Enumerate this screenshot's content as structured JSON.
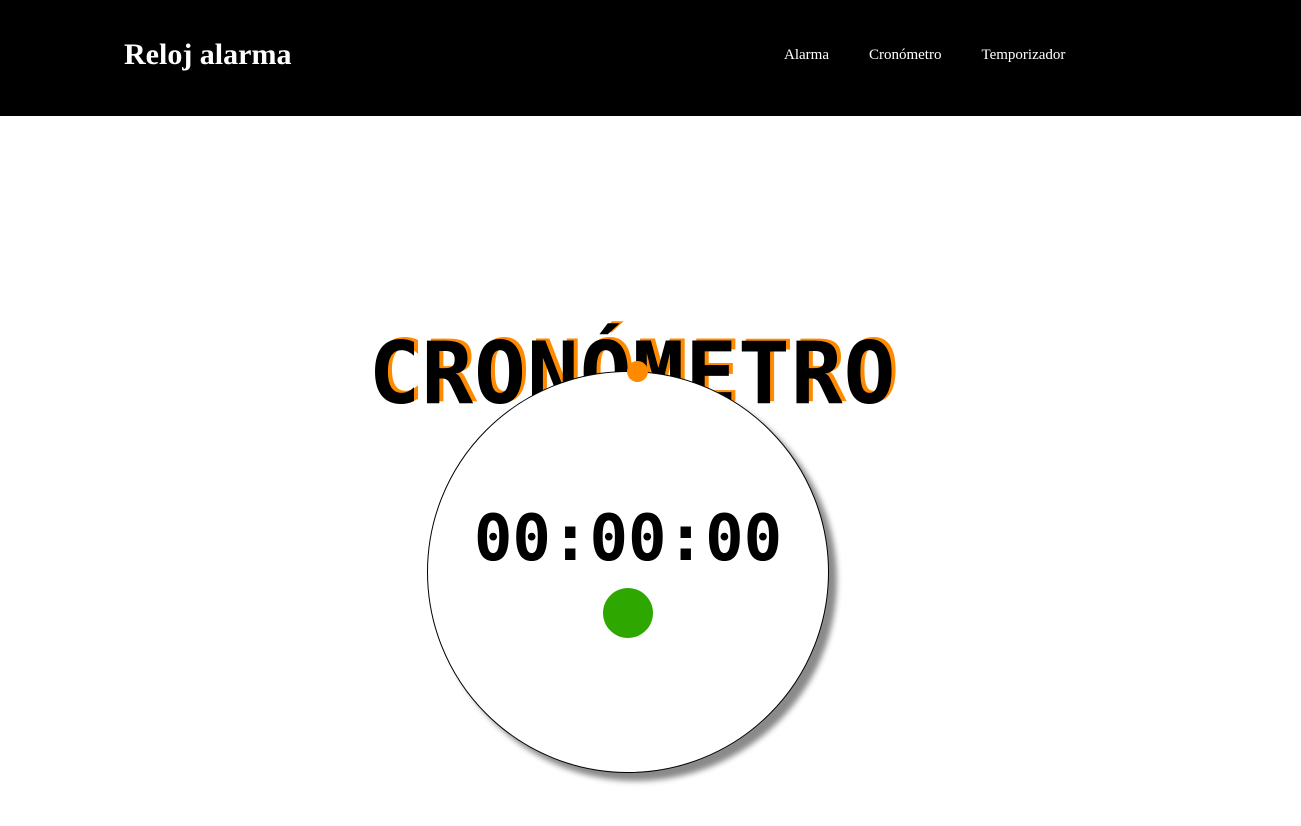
{
  "header": {
    "brand": "Reloj alarma",
    "nav": [
      {
        "label": "Alarma"
      },
      {
        "label": "Cronómetro"
      },
      {
        "label": "Temporizador"
      }
    ]
  },
  "main": {
    "title": "CRONÓMETRO",
    "time": "00:00:00"
  },
  "colors": {
    "header_bg": "#000000",
    "title_shadow": "#ff8a00",
    "orbit_dot": "#ff8a00",
    "start_button": "#2ea800"
  }
}
